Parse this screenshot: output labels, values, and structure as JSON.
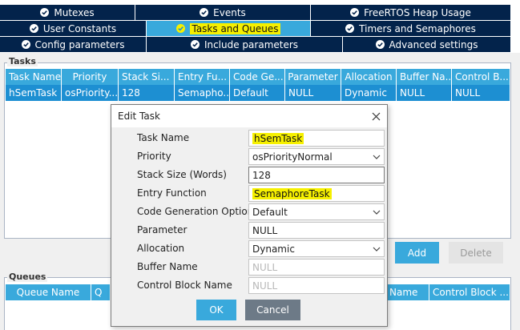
{
  "tabs": {
    "row1": [
      "Mutexes",
      "Events",
      "FreeRTOS Heap Usage"
    ],
    "row2": [
      "User Constants",
      "Tasks and Queues",
      "Timers and Semaphores"
    ],
    "row3": [
      "Config parameters",
      "Include parameters",
      "Advanced settings"
    ],
    "active": "Tasks and Queues"
  },
  "tasks": {
    "label": "Tasks",
    "columns": [
      "Task Name",
      "Priority",
      "Stack Si...",
      "Entry Fu...",
      "Code Ge...",
      "Parameter",
      "Allocation",
      "Buffer Na...",
      "Control B..."
    ],
    "rows": [
      [
        "hSemTask",
        "osPriority...",
        "128",
        "Semapho...",
        "Default",
        "NULL",
        "Dynamic",
        "NULL",
        "NULL"
      ]
    ],
    "add_label": "Add",
    "delete_label": "Delete"
  },
  "queues": {
    "label": "Queues",
    "columns": [
      "Queue Name",
      "Q",
      "Name",
      "Control Block ..."
    ]
  },
  "dialog": {
    "title": "Edit Task",
    "fields": [
      {
        "label": "Task Name",
        "value": "hSemTask"
      },
      {
        "label": "Priority",
        "value": "osPriorityNormal"
      },
      {
        "label": "Stack Size (Words)",
        "value": "128"
      },
      {
        "label": "Entry Function",
        "value": "SemaphoreTask"
      },
      {
        "label": "Code Generation Option",
        "value": "Default"
      },
      {
        "label": "Parameter",
        "value": "NULL"
      },
      {
        "label": "Allocation",
        "value": "Dynamic"
      },
      {
        "label": "Buffer Name",
        "value": "NULL"
      },
      {
        "label": "Control Block Name",
        "value": "NULL"
      }
    ],
    "ok_label": "OK",
    "cancel_label": "Cancel"
  },
  "colors": {
    "tab_bg": "#03234b",
    "tab_active": "#39a9dc",
    "grid_header": "#39a9dc",
    "row_selected": "#1d8fd2",
    "highlight": "#f6f000"
  },
  "icons": {
    "tab": "check-circle-icon",
    "close": "close-icon",
    "dropdown": "chevron-down-icon"
  }
}
